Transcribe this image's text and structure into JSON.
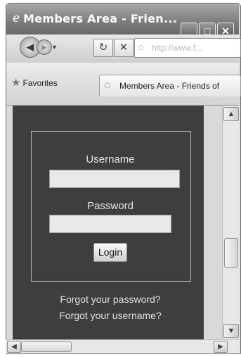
{
  "window": {
    "title": "Members Area - Frien...",
    "minimize": "_",
    "maximize": "□",
    "close": "✕"
  },
  "nav": {
    "back_glyph": "◀",
    "forward_glyph": "▶",
    "dropdown_glyph": "▾",
    "refresh_glyph": "↻",
    "stop_glyph": "✕",
    "address_icon": "◌",
    "address_text": "http://www.f..."
  },
  "favorites": {
    "label": "Favorites",
    "star_glyph": "★"
  },
  "tab": {
    "icon": "◌",
    "label": "Members Area - Friends of"
  },
  "login": {
    "username_label": "Username",
    "username_value": "",
    "password_label": "Password",
    "password_value": "",
    "button_label": "Login",
    "forgot_password": "Forgot your password?",
    "forgot_username": "Forgot your username?"
  },
  "scrollbars": {
    "up_glyph": "▲",
    "down_glyph": "▼",
    "left_glyph": "◀",
    "right_glyph": "▶"
  },
  "colors": {
    "page_background": "#3e3e3e",
    "titlebar": "#7c7c7c"
  }
}
